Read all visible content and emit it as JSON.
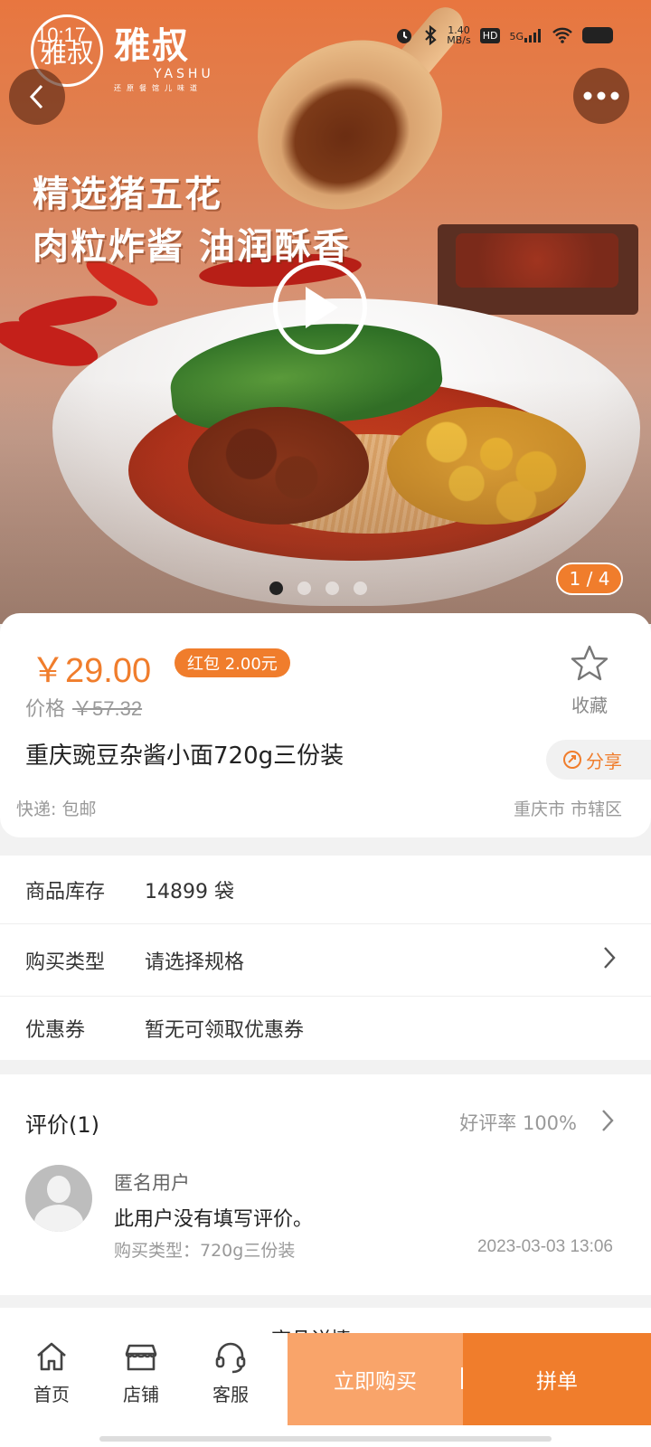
{
  "status_bar": {
    "time": "10:17",
    "network_speed": "1.40",
    "network_speed_unit": "MB/s",
    "hd": "HD",
    "network": "5G"
  },
  "hero": {
    "logo_mark": "雅叔",
    "brand_cn": "雅叔",
    "brand_en": "YASHU",
    "brand_tagline": "还原餐馆儿味道",
    "slogan_line1": "精选猪五花",
    "slogan_line2": "肉粒炸酱 油润酥香",
    "image_counter": "1 / 4",
    "current_slide": 1,
    "total_slides": 4
  },
  "product": {
    "price": "￥29.00",
    "red_packet": "红包 2.00元",
    "original_price_label": "价格",
    "original_price": "￥57.32",
    "favorite_label": "收藏",
    "title": "重庆豌豆杂酱小面720g三份装",
    "share_label": "分享",
    "shipping": "快递: 包邮",
    "location": "重庆市 市辖区"
  },
  "info_rows": {
    "stock_label": "商品库存",
    "stock_value": "14899 袋",
    "type_label": "购买类型",
    "type_value": "请选择规格",
    "coupon_label": "优惠券",
    "coupon_value": "暂无可领取优惠券"
  },
  "reviews": {
    "title": "评价(1)",
    "rating": "好评率 100%",
    "items": [
      {
        "user": "匿名用户",
        "text": "此用户没有填写评价。",
        "type": "购买类型：720g三份装",
        "time": "2023-03-03 13:06"
      }
    ]
  },
  "detail_section_title": "商品详情",
  "bottom_bar": {
    "home": "首页",
    "store": "店铺",
    "service": "客服",
    "buy_now": "立即购买",
    "group_buy": "拼单"
  },
  "colors": {
    "accent": "#f07d2c",
    "accent_light": "#f9a46a",
    "muted_text": "#999999"
  }
}
